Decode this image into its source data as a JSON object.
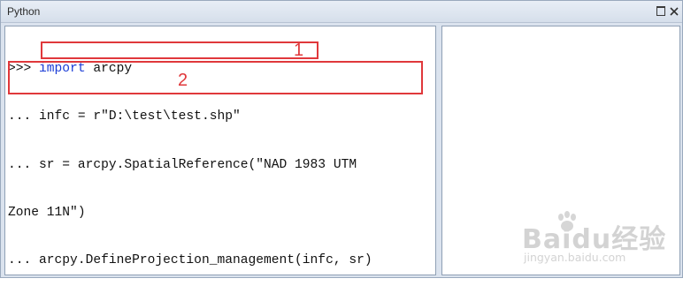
{
  "window": {
    "title": "Python"
  },
  "console": {
    "lines": [
      {
        "prompt": ">>> ",
        "keyword": "import",
        "text": " arcpy"
      },
      {
        "prompt": "... ",
        "keyword": "",
        "text": "infc = r\"D:\\test\\test.shp\""
      },
      {
        "prompt": "... ",
        "keyword": "",
        "text": "sr = arcpy.SpatialReference(\"NAD 1983 UTM"
      },
      {
        "prompt": "",
        "keyword": "",
        "text": "Zone 11N\")"
      },
      {
        "prompt": "... ",
        "keyword": "",
        "text": "arcpy.DefineProjection_management(infc, sr)"
      }
    ]
  },
  "annotations": {
    "box1_label": "1",
    "box2_label": "2",
    "color": "#e0383b"
  },
  "watermark": {
    "logo": "Baidu经验",
    "url": "jingyan.baidu.com"
  },
  "icons": [
    "restore-icon",
    "close-icon",
    "paw-icon"
  ]
}
